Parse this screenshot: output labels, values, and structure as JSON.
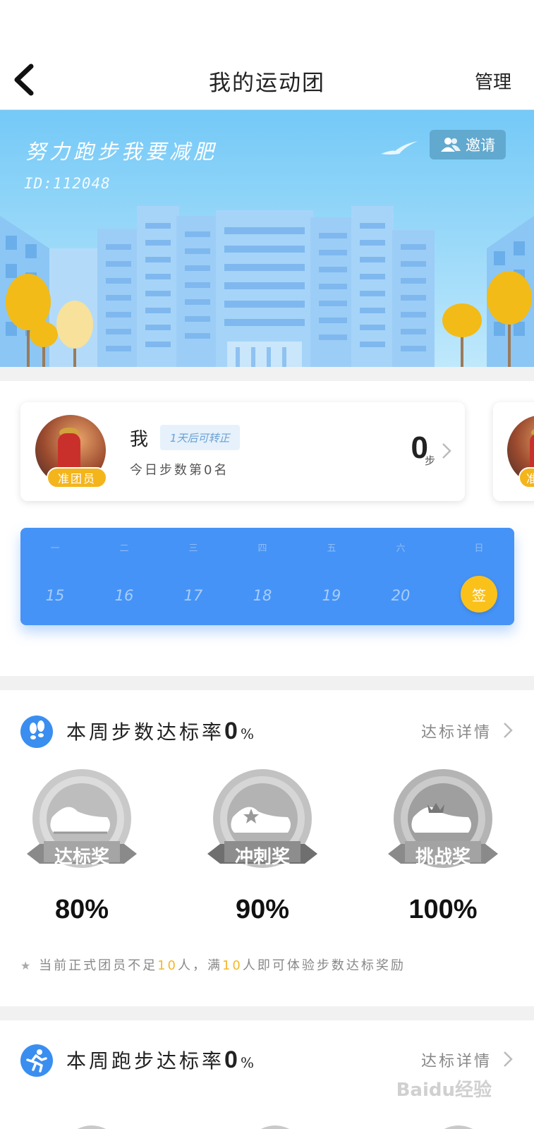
{
  "nav": {
    "title": "我的运动团",
    "manage_label": "管理"
  },
  "banner": {
    "team_name": "努力跑步我要减肥",
    "team_id": "ID:112048",
    "invite_label": "邀请"
  },
  "members": [
    {
      "name": "我",
      "tag": "1天后可转正",
      "rank_text": "今日步数第0名",
      "role": "准团员",
      "steps": "0",
      "steps_unit": "步"
    },
    {
      "role": "准"
    }
  ],
  "week": {
    "days": [
      "一",
      "二",
      "三",
      "四",
      "五",
      "六",
      "日"
    ],
    "dates": [
      "15",
      "16",
      "17",
      "18",
      "19",
      "20"
    ],
    "sign_label": "签"
  },
  "step_rate": {
    "title": "本周步数达标率",
    "value": "0",
    "unit": "%",
    "detail_label": "达标详情",
    "medals": [
      {
        "label": "达标奖",
        "percent": "80%"
      },
      {
        "label": "冲刺奖",
        "percent": "90%"
      },
      {
        "label": "挑战奖",
        "percent": "100%"
      }
    ],
    "note_prefix": "当前正式团员不足",
    "note_n1": "10",
    "note_mid": "人，满",
    "note_n2": "10",
    "note_suffix": "人即可体验步数达标奖励"
  },
  "run_rate": {
    "title": "本周跑步达标率",
    "value": "0",
    "unit": "%",
    "detail_label": "达标详情"
  },
  "watermark": "Baidu经验",
  "colors": {
    "accent_blue": "#4593f7",
    "sign_yellow": "#fbc11b",
    "badge_yellow": "#f4b51c",
    "highlight": "#f3b82a"
  }
}
